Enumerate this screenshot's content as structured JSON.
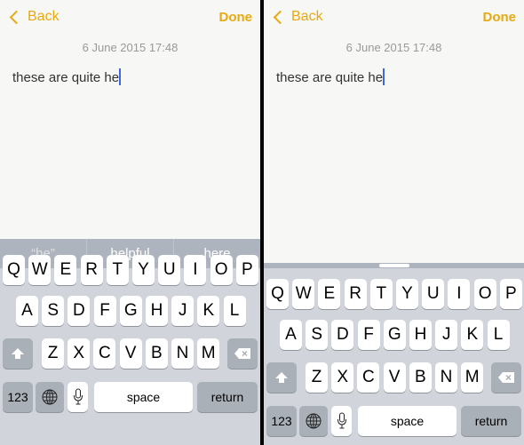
{
  "colors": {
    "accent": "#e6a90f",
    "caret": "#3c67e8"
  },
  "panes": [
    {
      "nav": {
        "back_label": "Back",
        "done_label": "Done"
      },
      "date": "6 June 2015 17:48",
      "note_text": "these are quite he",
      "predictive_bar": {
        "visible": true,
        "suggestions": [
          "“he”",
          "helpful",
          "here"
        ]
      }
    },
    {
      "nav": {
        "back_label": "Back",
        "done_label": "Done"
      },
      "date": "6 June 2015 17:48",
      "note_text": "these are quite he",
      "predictive_bar": {
        "visible": false,
        "suggestions": []
      }
    }
  ],
  "keyboard": {
    "row1": [
      "Q",
      "W",
      "E",
      "R",
      "T",
      "Y",
      "U",
      "I",
      "O",
      "P"
    ],
    "row2": [
      "A",
      "S",
      "D",
      "F",
      "G",
      "H",
      "J",
      "K",
      "L"
    ],
    "row3": [
      "Z",
      "X",
      "C",
      "V",
      "B",
      "N",
      "M"
    ],
    "shift_icon": "shift-arrow-icon",
    "delete_icon": "backspace-icon",
    "numbers_label": "123",
    "globe_icon": "globe-icon",
    "mic_icon": "microphone-icon",
    "space_label": "space",
    "return_label": "return"
  }
}
